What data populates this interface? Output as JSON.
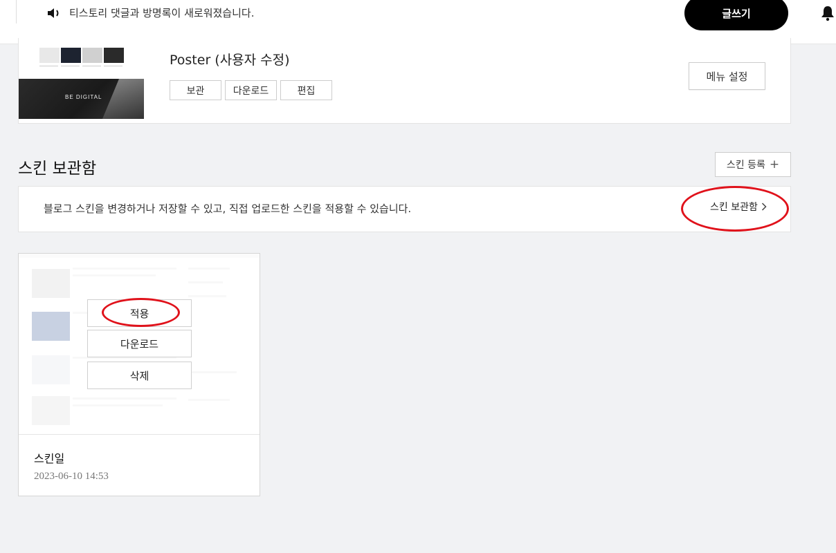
{
  "header": {
    "notice_icon": "speaker-icon",
    "notice": "티스토리 댓글과 방명록이 새로워졌습니다.",
    "write_button": "글쓰기",
    "bell_icon": "bell-icon"
  },
  "current_skin": {
    "thumbnail_text": "BE DIGITAL",
    "name": "Poster (사용자 수정)",
    "actions": [
      "보관",
      "다운로드",
      "편집"
    ],
    "menu_settings": "메뉴 설정"
  },
  "storage": {
    "title": "스킨 보관함",
    "register_button": "스킨 등록",
    "register_icon": "plus-icon",
    "description": "블로그 스킨을 변경하거나 저장할 수 있고, 직접 업로드한 스킨을 적용할 수 있습니다.",
    "link": "스킨 보관함",
    "link_icon": "chevron-right-icon"
  },
  "stored_skin": {
    "apply": "적용",
    "download": "다운로드",
    "delete": "삭제",
    "name": "스킨일",
    "date": "2023-06-10 14:53"
  },
  "annotation_color": "#e0121b"
}
